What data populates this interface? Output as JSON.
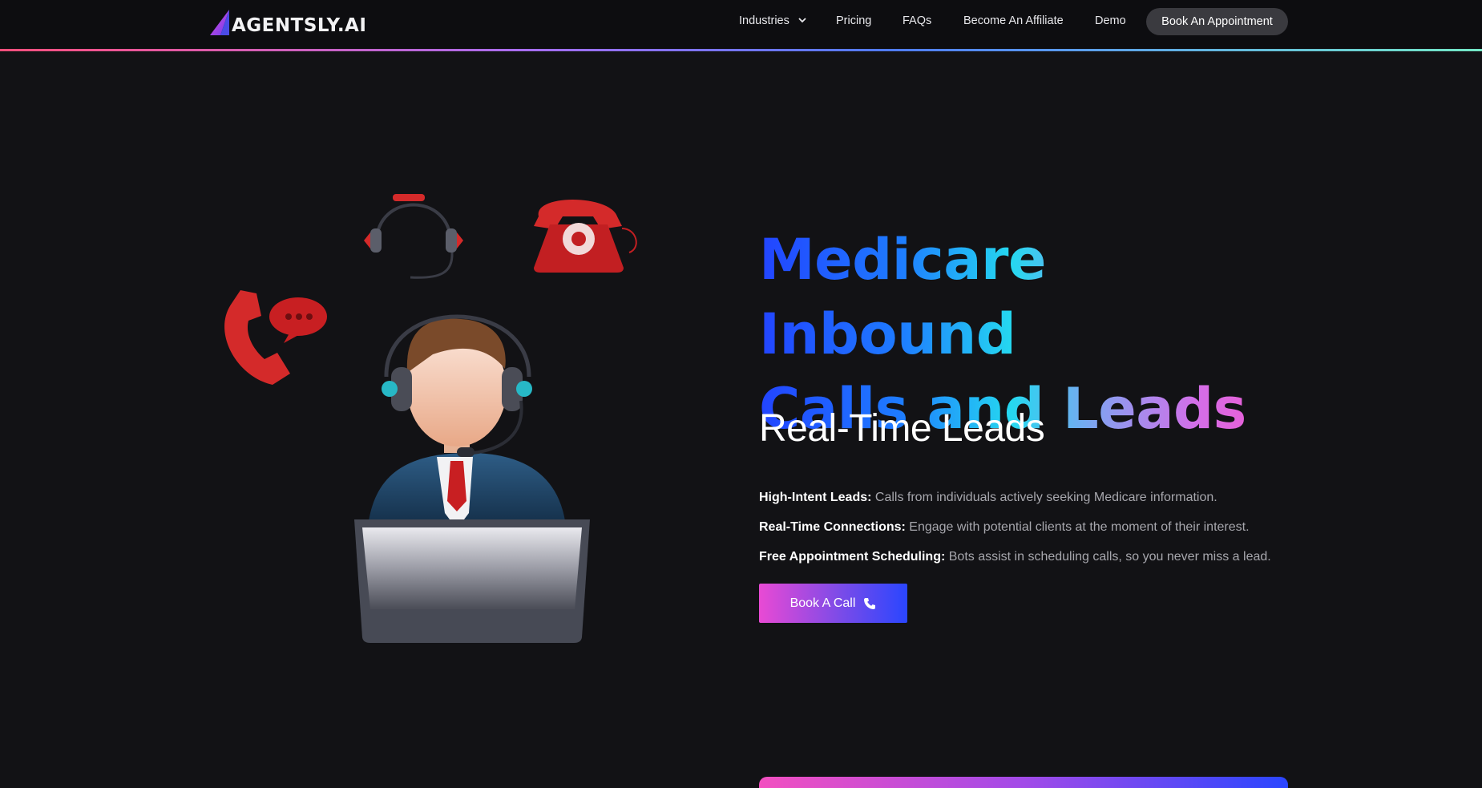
{
  "header": {
    "logo_text": "AGENTSLY.AI",
    "nav": {
      "industries": "Industries",
      "pricing": "Pricing",
      "faqs": "FAQs",
      "affiliate": "Become An Affiliate",
      "demo": "Demo"
    },
    "cta_label": "Book An Appointment"
  },
  "hero": {
    "title_line1": "Medicare Inbound",
    "title_line2": "Calls and Leads",
    "typed_text": "Real-Time Leads",
    "features": [
      {
        "strong": "High-Intent Leads:",
        "text": " Calls from individuals actively seeking Medicare information."
      },
      {
        "strong": "Real-Time Connections:",
        "text": " Engage with potential clients at the moment of their interest."
      },
      {
        "strong": "Free Appointment Scheduling:",
        "text": " Bots assist in scheduling calls, so you never miss a lead."
      }
    ],
    "cta_label": "Book A Call"
  },
  "icons": {
    "logo": "logo-triangle-icon",
    "industries_dropdown": "chevron-down-icon",
    "cta": "phone-icon",
    "illustration": [
      "headset-icon",
      "rotary-telephone-icon",
      "phone-chat-bubble-icon",
      "call-center-agent-illustration"
    ]
  },
  "colors": {
    "background": "#121215",
    "header_bg": "#0d0d10",
    "title_gradient": [
      "#2244ff",
      "#25d8f0",
      "#ff4fc4"
    ],
    "cta_gradient": [
      "#e94ad4",
      "#2a46ff"
    ],
    "illustration_red": "#d42a2a"
  }
}
